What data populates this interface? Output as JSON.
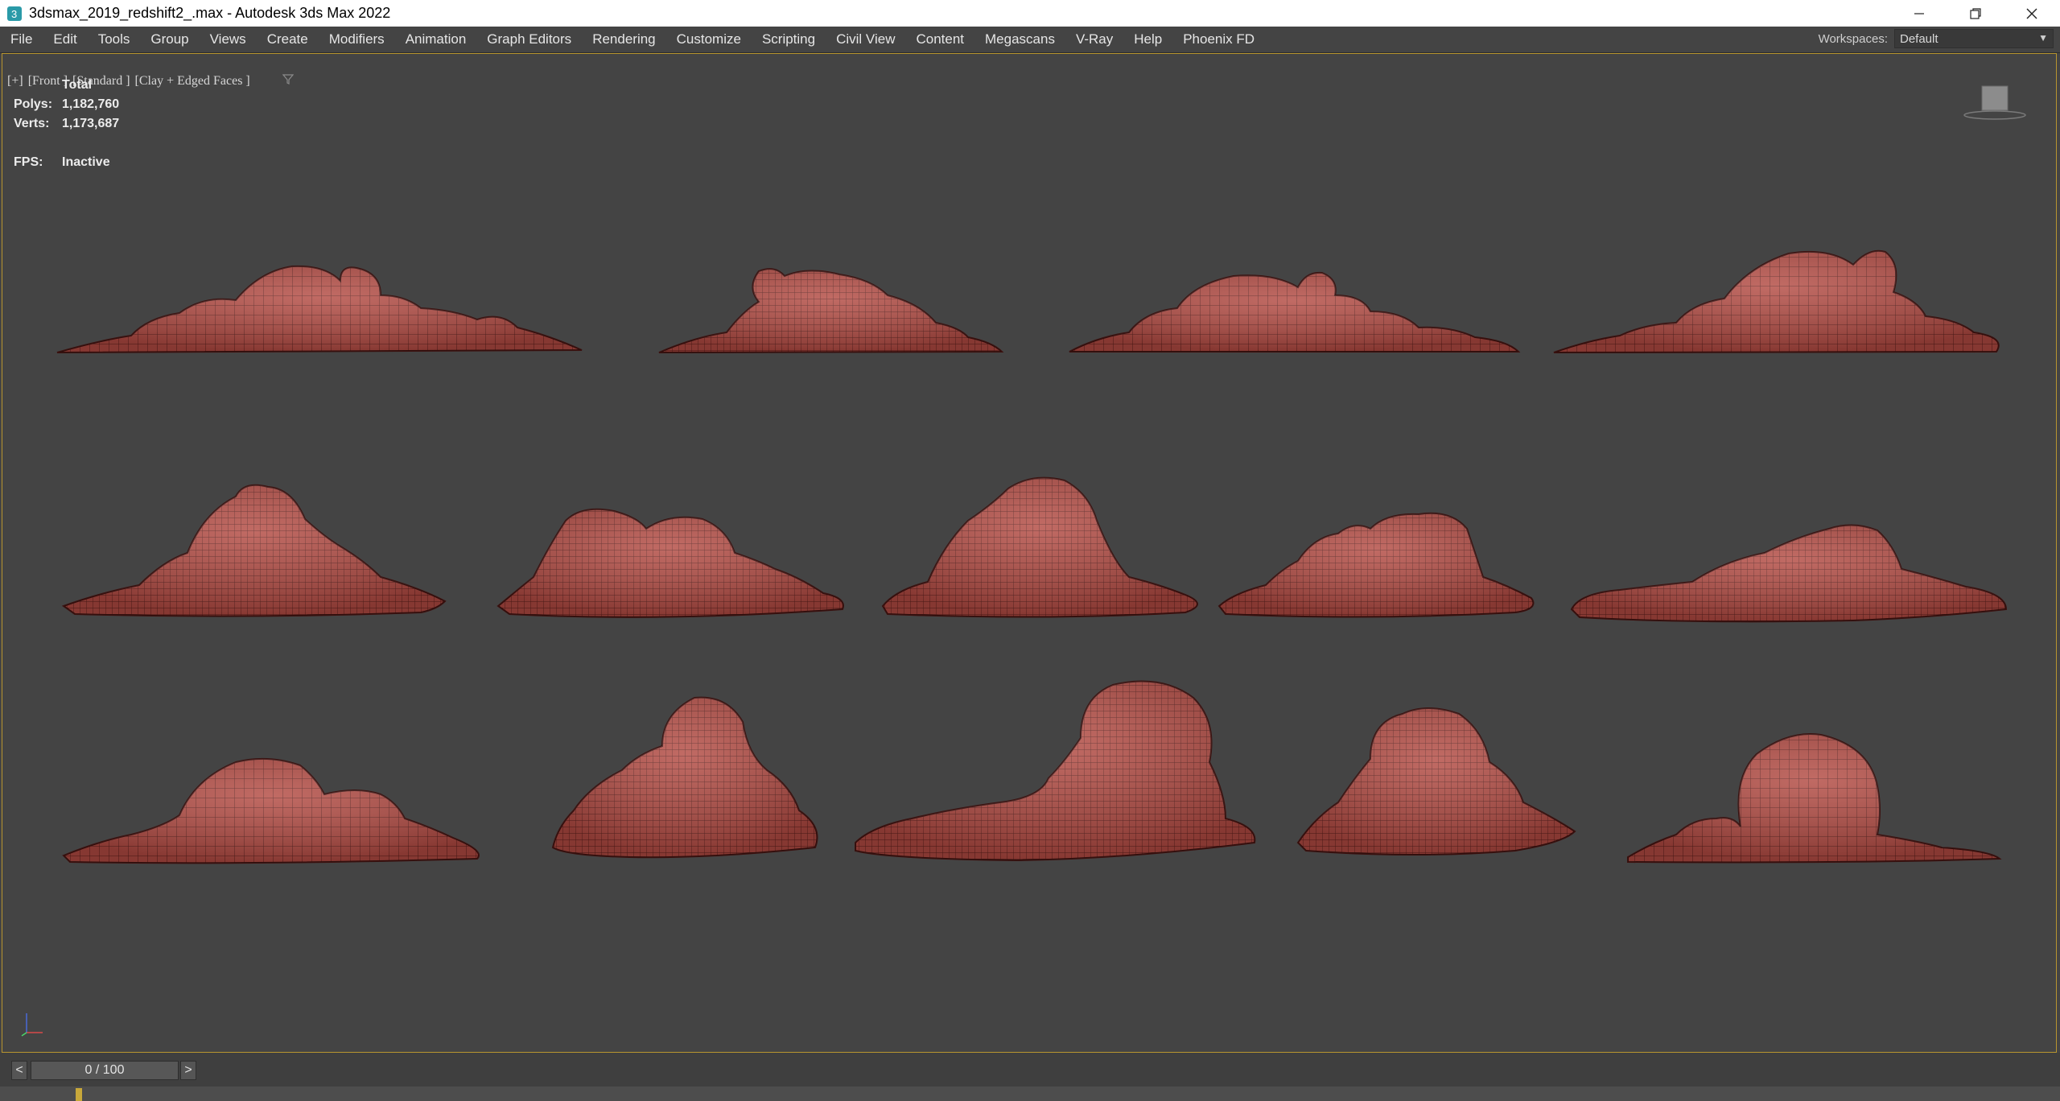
{
  "window": {
    "title": "3dsmax_2019_redshift2_.max - Autodesk 3ds Max 2022"
  },
  "menu": {
    "items": [
      "File",
      "Edit",
      "Tools",
      "Group",
      "Views",
      "Create",
      "Modifiers",
      "Animation",
      "Graph Editors",
      "Rendering",
      "Customize",
      "Scripting",
      "Civil View",
      "Content",
      "Megascans",
      "V-Ray",
      "Help",
      "Phoenix FD"
    ]
  },
  "workspaces": {
    "label": "Workspaces:",
    "value": "Default"
  },
  "viewport": {
    "label_parts": [
      "[+]",
      "[Front ]",
      "[Standard ]",
      "[Clay + Edged Faces ]"
    ],
    "stats": {
      "total_label": "Total",
      "polys_label": "Polys:",
      "polys_value": "1,182,760",
      "verts_label": "Verts:",
      "verts_value": "1,173,687",
      "fps_label": "FPS:",
      "fps_value": "Inactive"
    },
    "object_color": "#b34a42",
    "border_color": "#b8952f"
  },
  "timeline": {
    "prev": "<",
    "next": ">",
    "frame_label": "0 / 100",
    "current_frame": 0,
    "total_frames": 100
  }
}
